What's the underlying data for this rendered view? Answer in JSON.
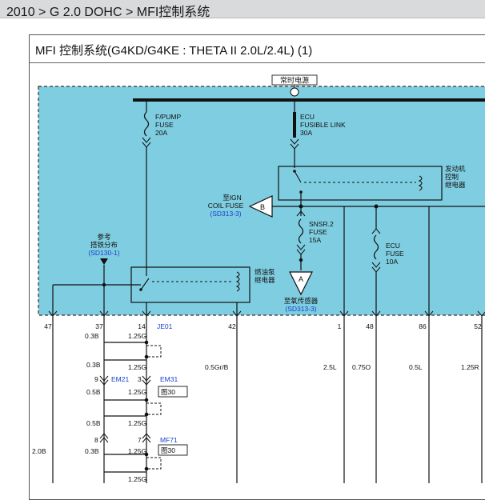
{
  "breadcrumb": "2010 > G 2.0 DOHC > MFI控制系统",
  "diagram_title": "MFI 控制系统(G4KD/G4KE : THETA II 2.0L/2.4L) (1)",
  "labels": {
    "constant_power": "常时电源",
    "fpump_fuse": [
      "F/PUMP",
      "FUSE",
      "20A"
    ],
    "ecu_fusible_link": [
      "ECU",
      "FUSIBLE LINK",
      "30A"
    ],
    "engine_relay": [
      "发动机",
      "控制",
      "继电器"
    ],
    "ign_coil_fuse": [
      "至IGN",
      "COIL FUSE"
    ],
    "ign_coil_ref": "(SD313-3)",
    "connector_b": "B",
    "snsr2_fuse": [
      "SNSR.2",
      "FUSE",
      "15A"
    ],
    "ecu_fuse": [
      "ECU",
      "FUSE",
      "10A"
    ],
    "ground_ref": [
      "参考",
      "搭铁分布"
    ],
    "ground_ref_code": "(SD130-1)",
    "fuel_pump_relay": [
      "燃油泵",
      "继电器"
    ],
    "connector_a": "A",
    "oxygen_sensor": "至氧传感器",
    "oxygen_sensor_ref": "(SD313-3)"
  },
  "pins": [
    "47",
    "37",
    "14",
    "42",
    "1",
    "48",
    "86",
    "52"
  ],
  "connectors": {
    "je01": "JE01",
    "em21": "EM21",
    "em31": "EM31",
    "mf71": "MF71",
    "em21_pin": "9",
    "em31_pin": "3",
    "mf71_pin_left": "8",
    "mf71_pin_right": "7",
    "fig30_a": "图30",
    "fig30_b": "图30"
  },
  "wires": {
    "w_03b_a": "0.3B",
    "w_125g_a": "1.25G",
    "w_03b_b": "0.3B",
    "w_125g_b": "1.25G",
    "w_05grb": "0.5Gr/B",
    "w_25l": "2.5L",
    "w_075o": "0.75O",
    "w_05l": "0.5L",
    "w_125r": "1.25R",
    "w_05b_a": "0.5B",
    "w_125g_c": "1.25G",
    "w_05b_b": "0.5B",
    "w_125g_d": "1.25G",
    "w_20b": "2.0B",
    "w_03b_c": "0.3B",
    "w_125g_e": "1.25G",
    "w_125g_f": "1.25G"
  },
  "colors": {
    "module_fill": "#7fcde0",
    "module_border": "#333333",
    "reference_text": "#1a3fd0",
    "wire": "#111111"
  }
}
